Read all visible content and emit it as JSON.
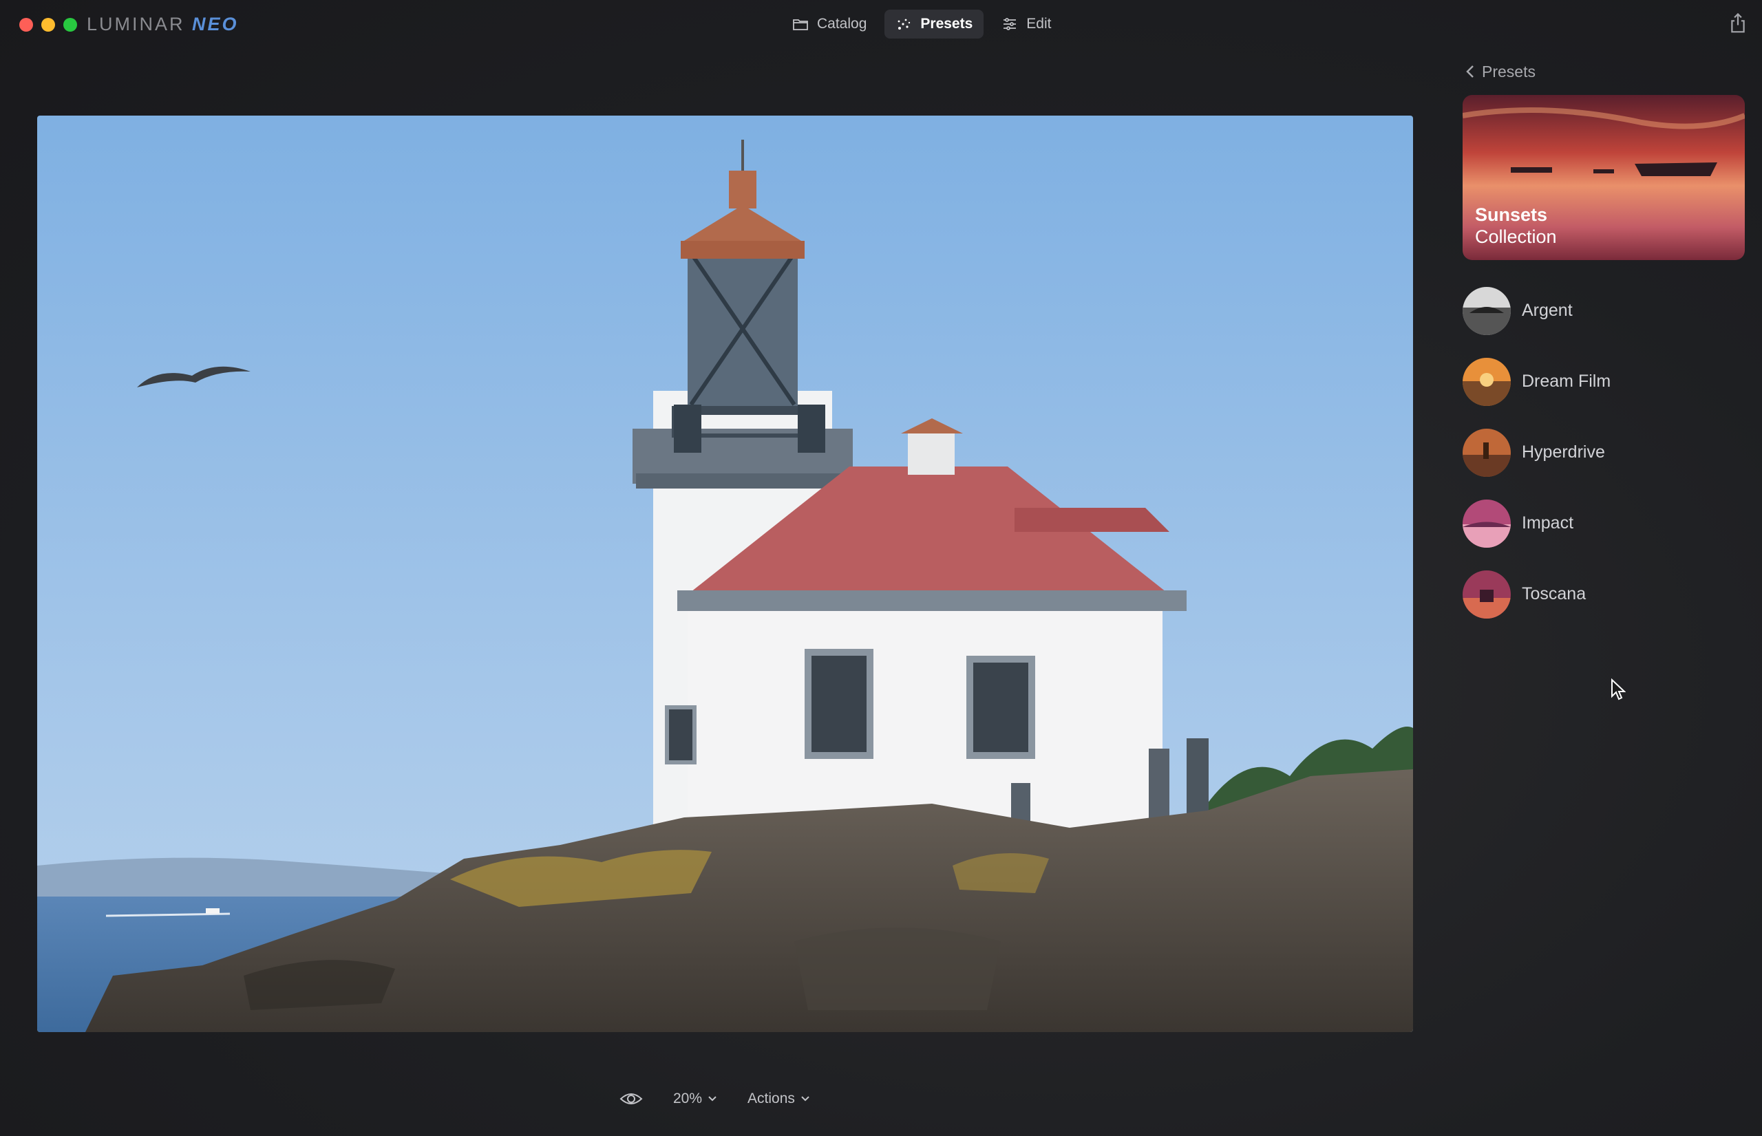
{
  "app": {
    "logo_text": "LUMINAR",
    "logo_accent": "NEO"
  },
  "modes": [
    {
      "label": "Catalog",
      "icon": "folder-icon"
    },
    {
      "label": "Presets",
      "icon": "presets-sparkle-icon",
      "active": true
    },
    {
      "label": "Edit",
      "icon": "sliders-icon"
    }
  ],
  "panel": {
    "back_label": "Presets",
    "collection": {
      "line1": "Sunsets",
      "line2": "Collection"
    },
    "presets": [
      {
        "label": "Argent"
      },
      {
        "label": "Dream Film"
      },
      {
        "label": "Hyperdrive"
      },
      {
        "label": "Impact"
      },
      {
        "label": "Toscana"
      }
    ]
  },
  "bottom": {
    "zoom": "20%",
    "actions": "Actions"
  },
  "colors": {
    "background": "#1e1f22",
    "active_mode_bg": "#2f3035",
    "logo_accent": "#5a8fd8"
  }
}
